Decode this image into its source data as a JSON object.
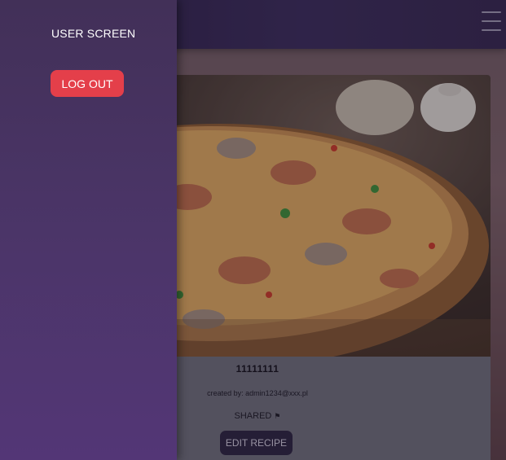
{
  "sidebar": {
    "title": "USER SCREEN",
    "logout_label": "LOG OUT"
  },
  "recipe": {
    "title": "11111111",
    "creator": "created by: admin1234@xxx.pl",
    "shared_label": "SHARED",
    "flag_glyph": "⚑",
    "edit_label": "EDIT RECIPE",
    "image_subject": "seafood pizza"
  },
  "icons": {
    "menu": "hamburger-menu-icon",
    "shared": "flag-icon"
  },
  "colors": {
    "logout_button": "#e43f4a",
    "sidebar": "#4b3568",
    "topbar": "#2c2148",
    "edit_button": "#2c2540"
  }
}
